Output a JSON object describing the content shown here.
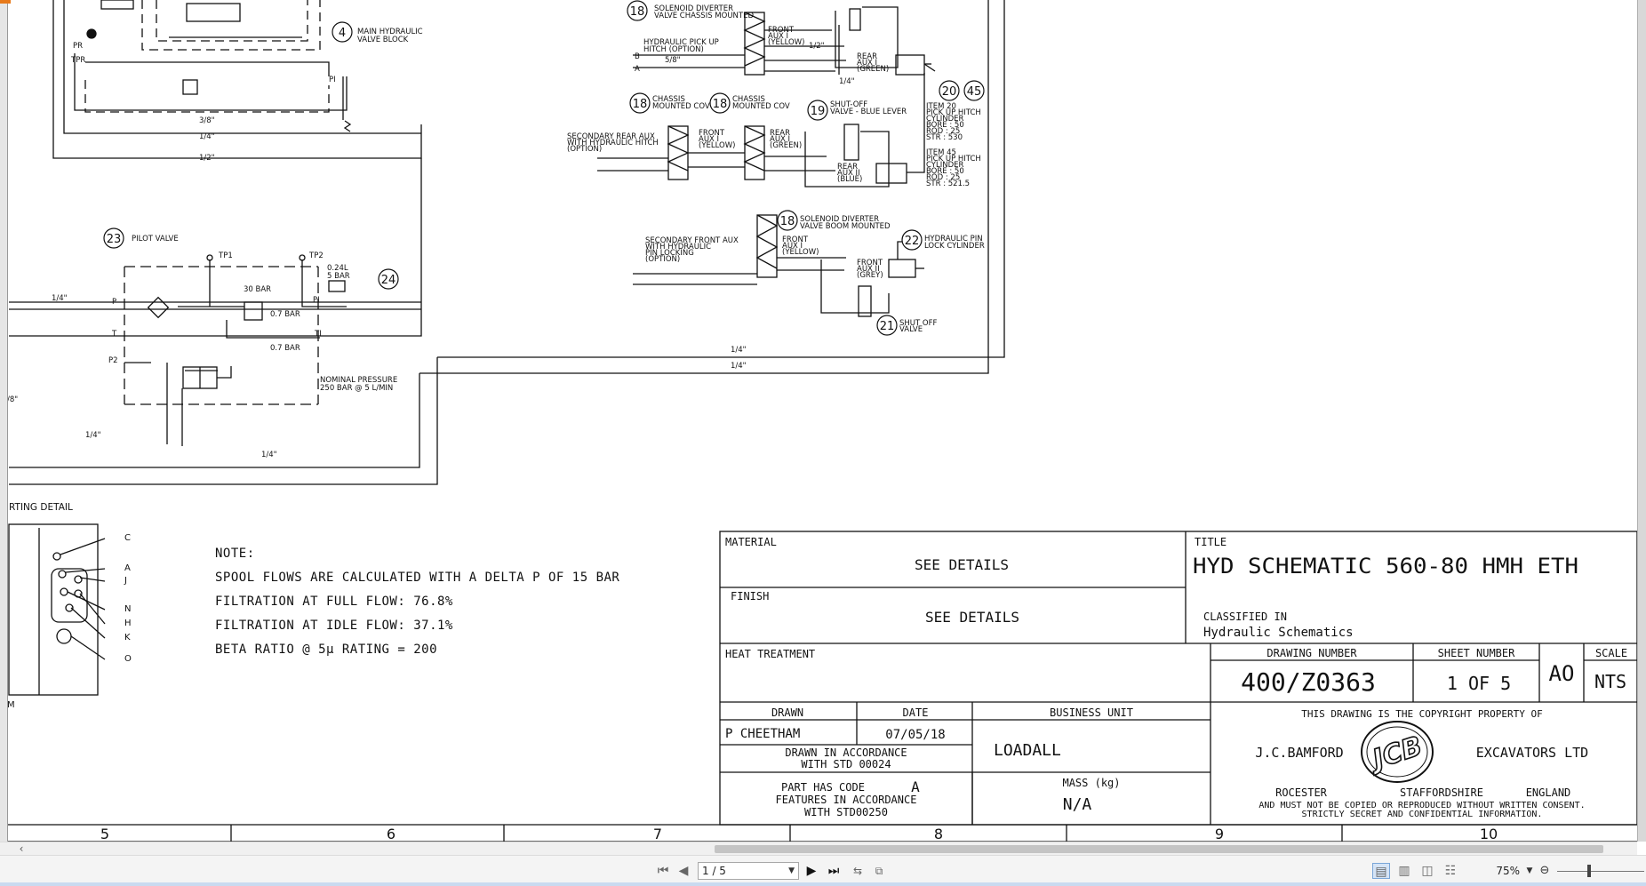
{
  "drawing": {
    "notes": {
      "heading": "NOTE:",
      "lines": [
        "SPOOL FLOWS ARE CALCULATED WITH A DELTA P OF 15 BAR",
        "FILTRATION AT FULL FLOW: 76.8%",
        "FILTRATION AT IDLE FLOW: 37.1%",
        "BETA RATIO @ 5µ RATING = 200"
      ]
    },
    "porting_detail_label": "RTING DETAIL",
    "port_letters": [
      "C",
      "A",
      "J",
      "N",
      "H",
      "K",
      "O",
      "M"
    ],
    "schematic_labels": {
      "main_valve_block_num": "4",
      "main_valve_block": [
        "MAIN HYDRAULIC",
        "VALVE BLOCK"
      ],
      "pilot_valve_num": "23",
      "pilot_valve": "PILOT VALVE",
      "accumulator_num": "24",
      "accumulator": [
        "0.24L",
        "5 BAR"
      ],
      "nominal_pressure": [
        "NOMINAL PRESSURE",
        "250 BAR @ 5 L/MIN"
      ],
      "bar_30": "30 BAR",
      "bar_07a": "0.7 BAR",
      "bar_07b": "0.7 BAR",
      "tp1": "TP1",
      "tp2": "TP2",
      "p": "P",
      "t": "T",
      "p2": "P2",
      "pi": "PI",
      "ti": "TI",
      "pr": "PR",
      "tpr": "TPR",
      "pi_top": "PI",
      "sizes": {
        "s38": "3/8\"",
        "s14a": "1/4\"",
        "s12": "1/2\"",
        "s14b": "1/4\"",
        "s14c": "1/4\"",
        "s14d": "1/4\"",
        "s14e": "1/4\"",
        "s14f": "1/4\"",
        "s38b": "/8\""
      },
      "div_chassis_num": "18",
      "div_chassis": [
        "SOLENOID DIVERTER",
        "VALVE CHASSIS MOUNTED"
      ],
      "hyd_pickup": [
        "HYDRAULIC PICK UP",
        "HITCH (OPTION)"
      ],
      "front_aux_yellow": [
        "FRONT",
        "AUX I",
        "(YELLOW)"
      ],
      "rear_aux_green": [
        "REAR",
        "AUX I",
        "(GREEN)"
      ],
      "num_20": "20",
      "num_45": "45",
      "item20": [
        "ITEM 20",
        "PICK UP HITCH",
        "CYLINDER",
        "BORE : 50",
        "ROD : 25",
        "STR : 530"
      ],
      "item45": [
        "ITEM 45",
        "PICK UP HITCH",
        "CYLINDER",
        "BORE : 50",
        "ROD : 25",
        "STR : 521.5"
      ],
      "chassis_cov_num_a": "18",
      "chassis_cov_a": [
        "CHASSIS",
        "MOUNTED COV"
      ],
      "chassis_cov_num_b": "18",
      "chassis_cov_b": [
        "CHASSIS",
        "MOUNTED COV"
      ],
      "shutoff_num": "19",
      "shutoff": [
        "SHUT-OFF",
        "VALVE - BLUE LEVER"
      ],
      "secondary_rear": [
        "SECONDARY REAR AUX",
        "WITH HYDRAULIC HITCH",
        "(OPTION)"
      ],
      "front_aux_yellow_b": [
        "FRONT",
        "AUX I",
        "(YELLOW)"
      ],
      "rear_aux_green_b": [
        "REAR",
        "AUX I",
        "(GREEN)"
      ],
      "rear_aux_blue": [
        "REAR",
        "AUX II",
        "(BLUE)"
      ],
      "boom_div_num": "18",
      "boom_div": [
        "SOLENOID DIVERTER",
        "VALVE BOOM MOUNTED"
      ],
      "pin_lock_num": "22",
      "pin_lock": [
        "HYDRAULIC PIN",
        "LOCK CYLINDER"
      ],
      "secondary_front": [
        "SECONDARY FRONT AUX",
        "WITH HYDRAULIC",
        "PIN LOCKING",
        "(OPTION)"
      ],
      "front_aux_yellow_c": [
        "FRONT",
        "AUX I",
        "(YELLOW)"
      ],
      "front_aux_grey": [
        "FRONT",
        "AUX II",
        "(GREY)"
      ],
      "shutoff2_num": "21",
      "shutoff2": [
        "SHUT OFF",
        "VALVE"
      ],
      "port_a": "A",
      "port_b": "B",
      "s58": "5/8\"",
      "s14": "1/4\"",
      "s12b": "1/2\""
    },
    "title_block": {
      "material_label": "MATERIAL",
      "material_value": "SEE DETAILS",
      "finish_label": "FINISH",
      "finish_value": "SEE DETAILS",
      "heat_label": "HEAT TREATMENT",
      "title_label": "TITLE",
      "title_value": "HYD SCHEMATIC 560-80 HMH ETH",
      "classified_label": "CLASSIFIED IN",
      "classified_value": "Hydraulic Schematics",
      "drawing_number_label": "DRAWING NUMBER",
      "drawing_number": "400/Z0363",
      "sheet_number_label": "SHEET NUMBER",
      "sheet_number": "1 OF 5",
      "size_value": "AO",
      "scale_label": "SCALE",
      "scale_value": "NTS",
      "drawn_label": "DRAWN",
      "drawn_value": "P CHEETHAM",
      "date_label": "DATE",
      "date_value": "07/05/18",
      "business_label": "BUSINESS UNIT",
      "business_value": "LOADALL",
      "accord_1": "DRAWN IN ACCORDANCE",
      "accord_2": "WITH STD 00024",
      "part_code_1": "PART HAS CODE",
      "part_code_letter": "A",
      "part_code_2": "FEATURES IN ACCORDANCE",
      "part_code_3": "WITH STD00250",
      "mass_label": "MASS (kg)",
      "mass_value": "N/A",
      "copyright_1": "THIS DRAWING IS THE COPYRIGHT PROPERTY OF",
      "company_left": "J.C.BAMFORD",
      "logo": "JCB",
      "company_right": "EXCAVATORS LTD",
      "loc_1": "ROCESTER",
      "loc_2": "STAFFORDSHIRE",
      "loc_3": "ENGLAND",
      "copyright_2": "AND MUST NOT BE COPIED OR REPRODUCED WITHOUT WRITTEN CONSENT.",
      "copyright_3": "STRICTLY SECRET AND CONFIDENTIAL INFORMATION."
    },
    "zone_numbers": [
      "5",
      "6",
      "7",
      "8",
      "9",
      "10"
    ]
  },
  "toolbar": {
    "first_page": "⏮",
    "prev_page": "◀",
    "page_value": "1 / 5",
    "next_page": "▶",
    "last_page": "⏭",
    "zoom": "75%",
    "zoom_out": "⊖"
  }
}
